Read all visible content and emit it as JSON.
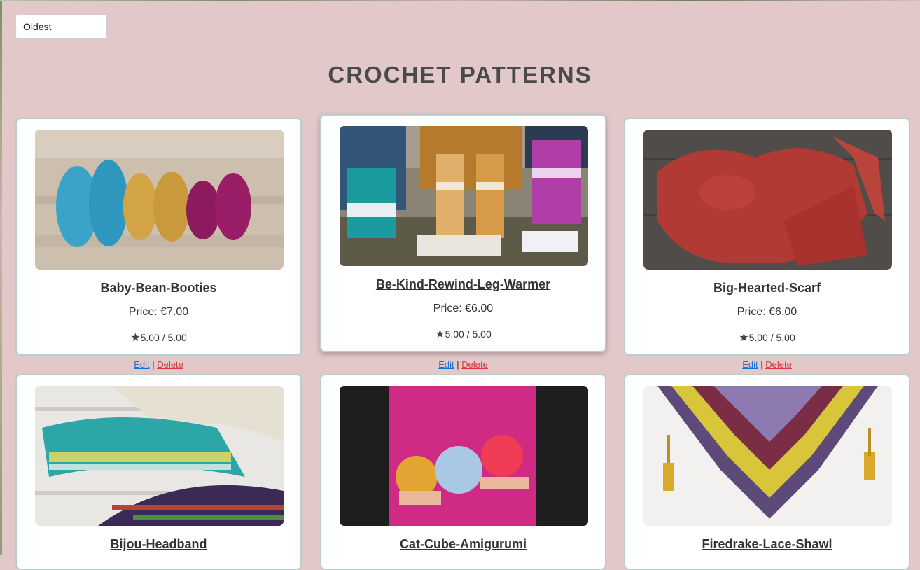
{
  "sort": {
    "selected": "Oldest"
  },
  "page_title": "CROCHET PATTERNS",
  "actions": {
    "edit": "Edit",
    "separator": "|",
    "delete": "Delete"
  },
  "products": [
    {
      "name": "Baby-Bean-Booties",
      "price": "Price: €7.00",
      "rating": "5.00 / 5.00"
    },
    {
      "name": "Be-Kind-Rewind-Leg-Warmer",
      "price": "Price: €6.00",
      "rating": "5.00 / 5.00"
    },
    {
      "name": "Big-Hearted-Scarf",
      "price": "Price: €6.00",
      "rating": "5.00 / 5.00"
    },
    {
      "name": "Bijou-Headband"
    },
    {
      "name": "Cat-Cube-Amigurumi"
    },
    {
      "name": "Firedrake-Lace-Shawl"
    }
  ],
  "icons": {
    "rating": "star-icon"
  },
  "colors": {
    "background": "#e2c8c9",
    "edit": "#1a6fd6",
    "delete": "#d83a3a",
    "card_border": "#b9cfc9"
  }
}
